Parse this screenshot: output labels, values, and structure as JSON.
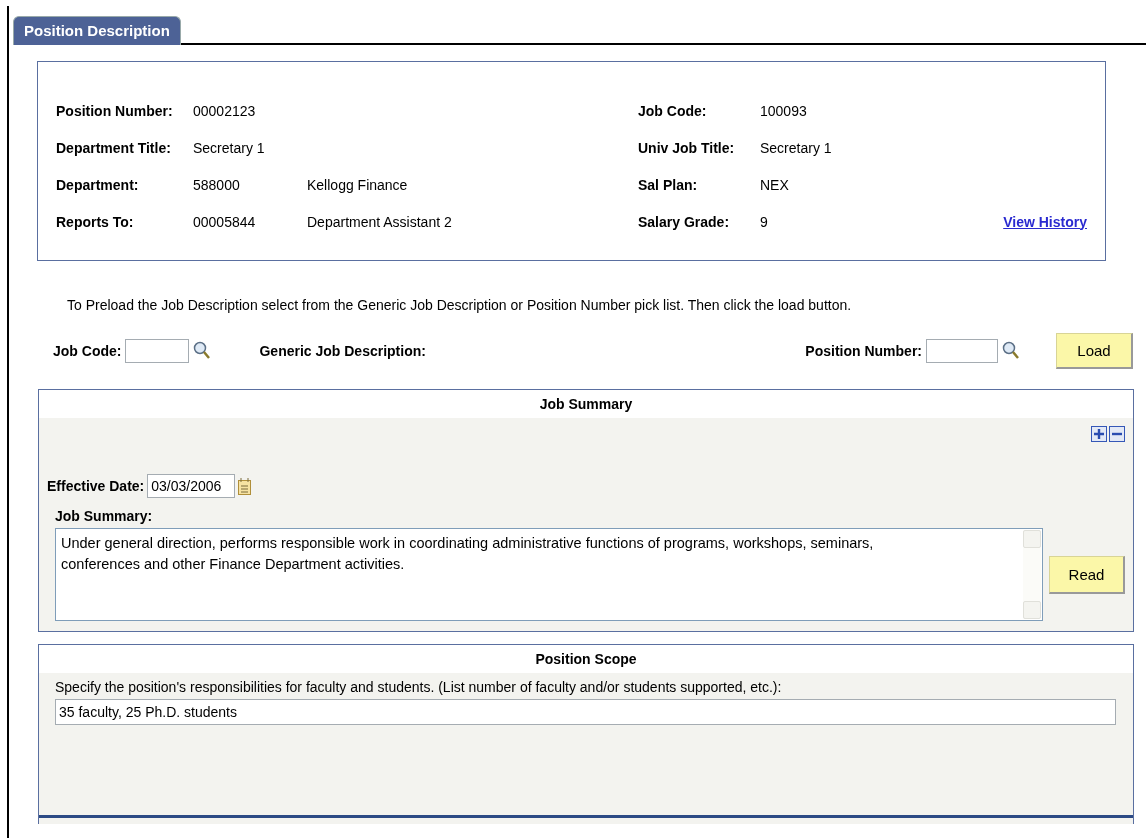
{
  "tabs": [
    {
      "label": "Position Description",
      "selected": true
    }
  ],
  "position_info": {
    "left": [
      {
        "label": "Position Number:",
        "value": "00002123"
      },
      {
        "label": "Department Title:",
        "value": "Secretary 1"
      },
      {
        "label": "Department:",
        "value": "588000",
        "detail": "Kellogg Finance"
      },
      {
        "label": "Reports To:",
        "value": "00005844",
        "detail": "Department Assistant 2"
      }
    ],
    "right": [
      {
        "label": "Job Code:",
        "value": "100093"
      },
      {
        "label": "Univ Job Title:",
        "value": "Secretary 1"
      },
      {
        "label": "Sal Plan:",
        "value": "NEX"
      },
      {
        "label": "Salary Grade:",
        "value": "9"
      }
    ],
    "link": "View History"
  },
  "preload": {
    "instruction": "To Preload the Job Description select from the Generic Job Description or Position Number pick list. Then click the load button.",
    "job_code_label": "Job Code:",
    "generic_label": "Generic Job Description:",
    "position_number_label": "Position Number:",
    "load_button": "Load"
  },
  "job_summary": {
    "title": "Job Summary",
    "effective_date_label": "Effective Date:",
    "effective_date": "03/03/2006",
    "summary_label": "Job Summary:",
    "summary_text": "Under general direction, performs responsible work in coordinating administrative functions of programs, workshops, seminars, conferences and other Finance Department activities.",
    "read_button": "Read"
  },
  "position_scope": {
    "title": "Position Scope",
    "prompt": "Specify the position's responsibilities for faculty and students. (List number of faculty and/or students supported, etc.):",
    "value": "35 faculty, 25 Ph.D. students"
  }
}
